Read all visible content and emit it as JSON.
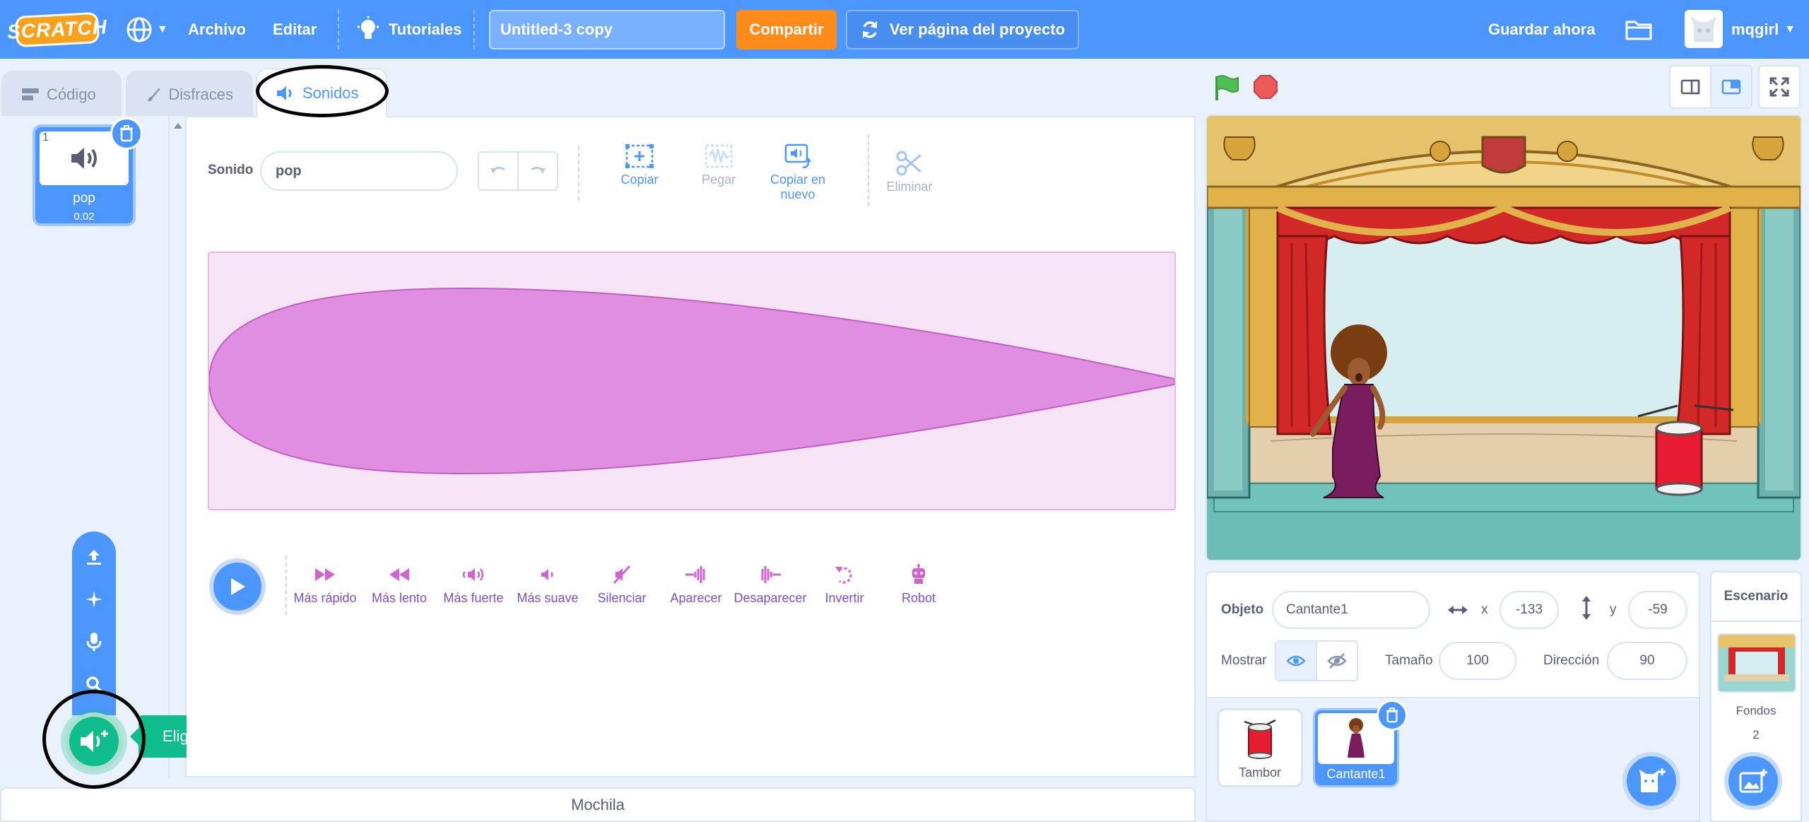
{
  "menu": {
    "logo": "SCRATCH",
    "file": "Archivo",
    "edit": "Editar",
    "tutorials": "Tutoriales",
    "project_title": "Untitled-3 copy",
    "share": "Compartir",
    "see_project_page": "Ver página del proyecto",
    "save_now": "Guardar ahora",
    "username": "mqgirl"
  },
  "tabs": {
    "code": "Código",
    "costumes": "Disfraces",
    "sounds": "Sonidos"
  },
  "sound_list": {
    "items": [
      {
        "index": "1",
        "name": "pop",
        "duration": "0.02"
      }
    ],
    "add_tooltip": "Elige un sonido"
  },
  "editor": {
    "sound_label": "Sonido",
    "sound_name": "pop",
    "tools": {
      "copy": "Copiar",
      "paste": "Pegar",
      "copy_new_line1": "Copiar en",
      "copy_new_line2": "nuevo",
      "delete": "Eliminar"
    },
    "effects": [
      "Más rápido",
      "Más lento",
      "Más fuerte",
      "Más suave",
      "Silenciar",
      "Aparecer",
      "Desaparecer",
      "Invertir",
      "Robot"
    ]
  },
  "backpack": "Mochila",
  "sprite_info": {
    "sprite_label": "Objeto",
    "sprite_name": "Cantante1",
    "x_label": "x",
    "x": "-133",
    "y_label": "y",
    "y": "-59",
    "show_label": "Mostrar",
    "size_label": "Tamaño",
    "size": "100",
    "direction_label": "Dirección",
    "direction": "90"
  },
  "sprites": [
    {
      "name": "Tambor",
      "selected": false
    },
    {
      "name": "Cantante1",
      "selected": true
    }
  ],
  "stage_pane": {
    "title": "Escenario",
    "backdrops_label": "Fondos",
    "backdrops_count": "2"
  },
  "colors": {
    "menu_blue": "#4c97ff",
    "share_orange": "#ff8c1a",
    "sound_green": "#0fbd8c",
    "wave_fill": "#e08fe0",
    "effect_purple": "#cf63cf"
  }
}
